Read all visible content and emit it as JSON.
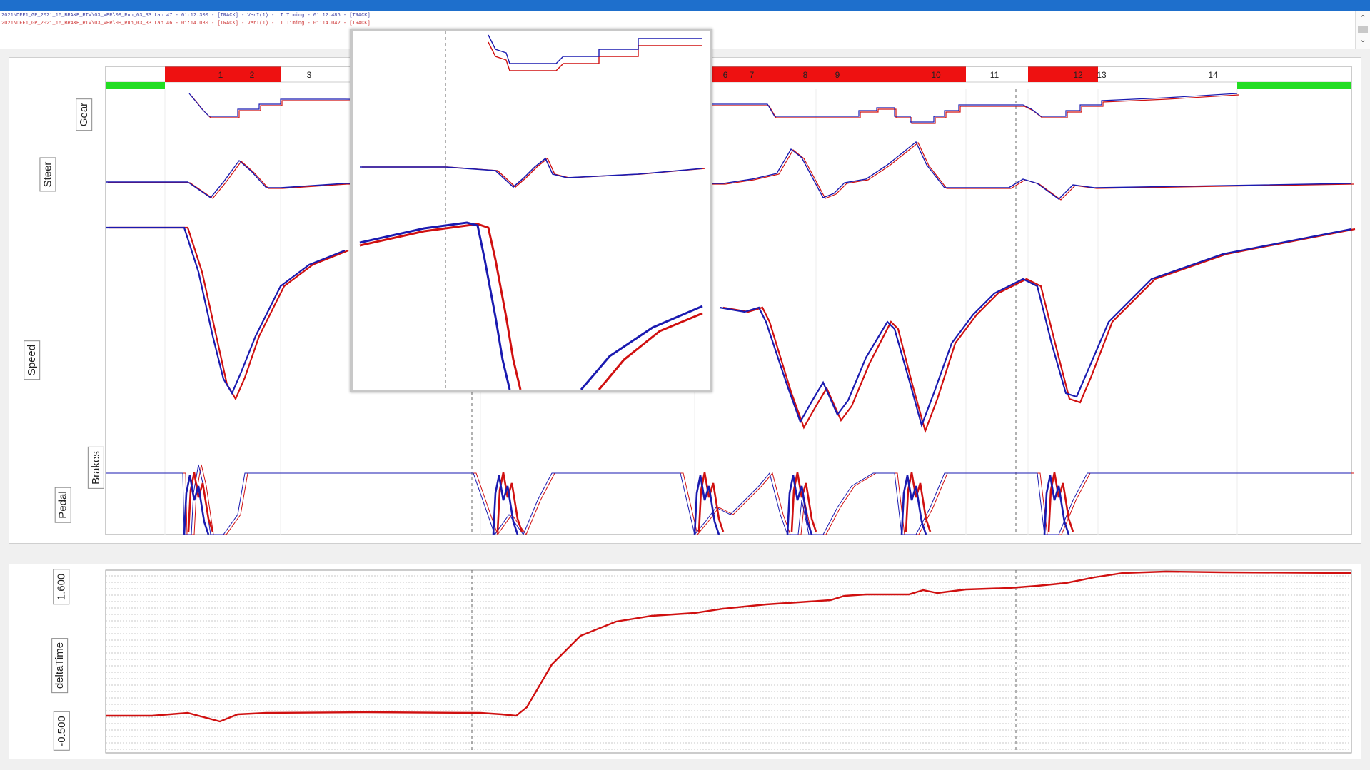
{
  "window": {
    "accent_color": "#1e6fcc"
  },
  "laps": [
    {
      "text": "2021\\DFF1_GP_2021_16_BRAKE_RTV\\03_VER\\09_Run_03_33 Lap 47 - 01:12.300 - [TRACK] - VerI(1) - LT Timing - 01:12.486 - [TRACK]",
      "color": "#3a3aa0"
    },
    {
      "text": "2021\\DFF1_GP_2021_16_BRAKE_RTV\\03_VER\\09_Run_03_33 Lap 46 - 01:14.030 - [TRACK] - VerI(1) - LT Timing - 01:14.042 - [TRACK]",
      "color": "#cc3030"
    }
  ],
  "scrollbar": {
    "up_icon": "chevron-up-icon",
    "down_icon": "chevron-down-icon"
  },
  "colors": {
    "lap_a": "#1a1ab0",
    "lap_b": "#d01010",
    "corner_fill": "#ee1111",
    "straight_fill": "#22dd22"
  },
  "corner_labels": [
    "1",
    "2",
    "3",
    "6",
    "7",
    "8",
    "9",
    "10",
    "11",
    "12",
    "13",
    "14"
  ],
  "channels": {
    "gear": "Gear",
    "steer": "Steer",
    "speed": "Speed",
    "brakes": "Brakes",
    "pedal": "Pedal"
  },
  "delta_panel": {
    "label": "deltaTime",
    "y_max_label": "1.600",
    "y_min_label": "-0.500"
  }
}
